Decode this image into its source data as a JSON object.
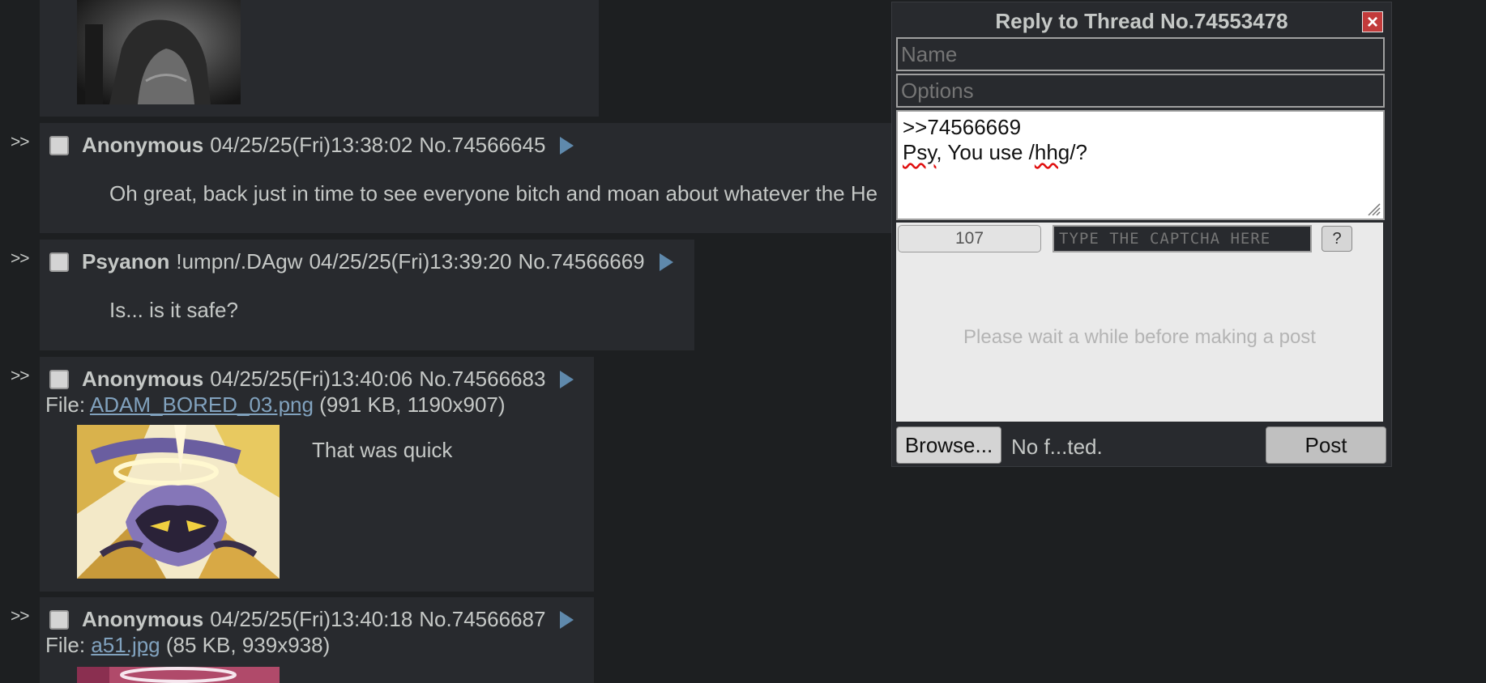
{
  "posts": [
    {
      "id": "74566645",
      "arrows": ">>",
      "name": "Anonymous",
      "trip": "",
      "date": "04/25/25(Fri)13:38:02",
      "no": "No.74566645",
      "body": "Oh great, back just in time to see everyone bitch and moan about whatever the He"
    },
    {
      "id": "74566669",
      "arrows": ">>",
      "name": "Psyanon",
      "trip": "!umpn/.DAgw",
      "date": "04/25/25(Fri)13:39:20",
      "no": "No.74566669",
      "body": "Is... is it safe?"
    },
    {
      "id": "74566683",
      "arrows": ">>",
      "name": "Anonymous",
      "trip": "",
      "date": "04/25/25(Fri)13:40:06",
      "no": "No.74566683",
      "file_prefix": "File: ",
      "file_name": "ADAM_BORED_03.png",
      "file_meta": " (991 KB, 1190x907)",
      "body": "That was quick"
    },
    {
      "id": "74566687",
      "arrows": ">>",
      "name": "Anonymous",
      "trip": "",
      "date": "04/25/25(Fri)13:40:18",
      "no": "No.74566687",
      "file_prefix": "File: ",
      "file_name": "a51.jpg",
      "file_meta": " (85 KB, 939x938)",
      "body": ""
    }
  ],
  "quick_reply": {
    "title": "Reply to Thread No.74553478",
    "close_icon": "×",
    "name_placeholder": "Name",
    "options_placeholder": "Options",
    "comment_line1": ">>74566669",
    "comment_line2_a": "Psy",
    "comment_line2_b": ", You use /",
    "comment_line2_c": "hhg",
    "comment_line2_d": "/?",
    "captcha_button": "107",
    "captcha_placeholder": "TYPE THE CAPTCHA HERE",
    "captcha_help": "?",
    "wait_message": "Please wait a while before making a post",
    "browse_label": "Browse...",
    "file_status": "No f...ted.",
    "post_label": "Post"
  },
  "colors": {
    "background": "#1d1f21",
    "post_bg": "#282a2e",
    "link": "#81a2be",
    "menu_arrow": "#5f89ac"
  }
}
